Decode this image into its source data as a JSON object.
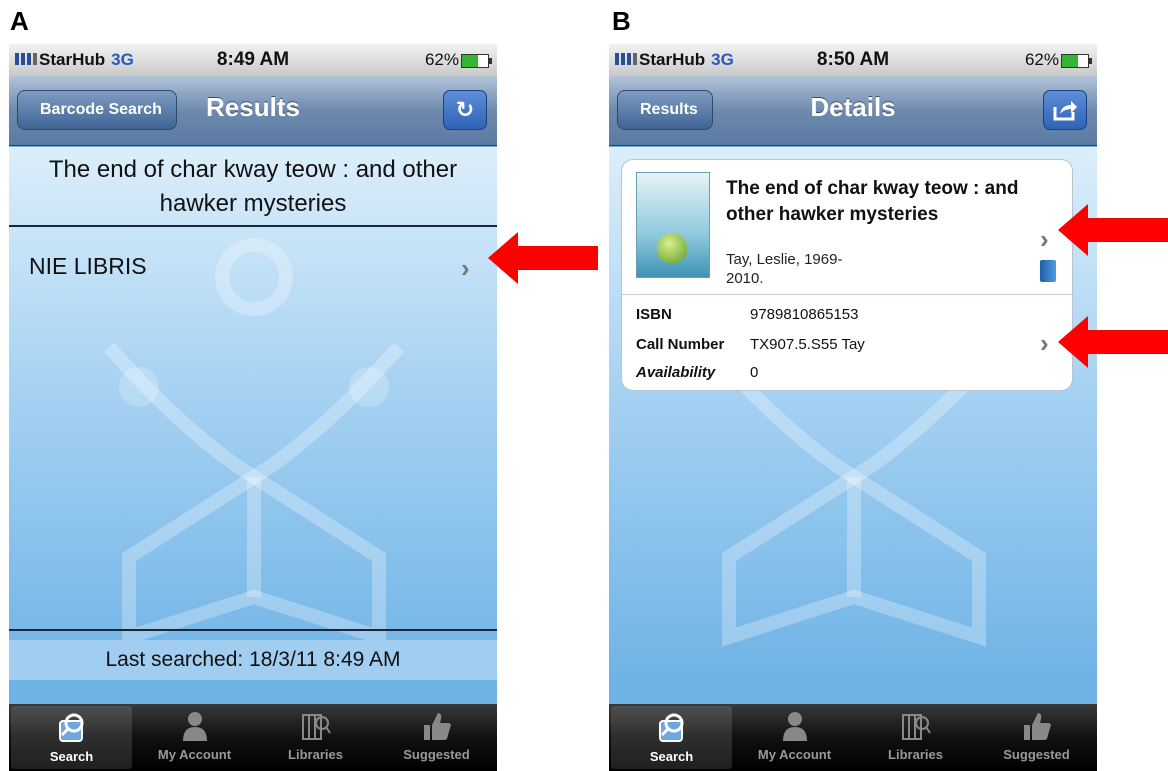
{
  "panels": [
    {
      "label": "A",
      "status": {
        "carrier": "StarHub",
        "network": "3G",
        "time": "8:49 AM",
        "battery": "62%"
      },
      "nav": {
        "back": "Barcode Search",
        "title": "Results",
        "action_icon": "refresh-icon"
      },
      "heading": "The end of char kway teow : and other hawker mysteries",
      "source": "NIE LIBRIS",
      "footer": "Last searched: 18/3/11 8:49 AM"
    },
    {
      "label": "B",
      "status": {
        "carrier": "StarHub",
        "network": "3G",
        "time": "8:50 AM",
        "battery": "62%"
      },
      "nav": {
        "back": "Results",
        "title": "Details",
        "action_icon": "share-icon"
      },
      "book": {
        "title": "The end of char kway teow : and other hawker mysteries",
        "author": "Tay, Leslie, 1969-\n2010.",
        "fields": [
          {
            "label": "ISBN",
            "value": "9789810865153"
          },
          {
            "label": "Call Number",
            "value": "TX907.5.S55 Tay"
          },
          {
            "label": "Availability",
            "value": "0"
          }
        ]
      }
    }
  ],
  "tabs": [
    "Search",
    "My Account",
    "Libraries",
    "Suggested"
  ],
  "colors": {
    "arrow": "#ff0000",
    "nav_button": "#2f63b6",
    "background": "#6fb3e6"
  }
}
